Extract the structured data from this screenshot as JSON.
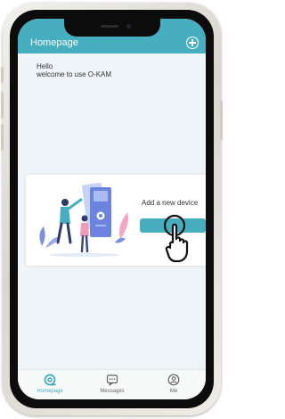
{
  "header": {
    "title": "Homepage",
    "add_icon": "plus-circle-icon"
  },
  "greeting": {
    "line1": "Hello",
    "line2": "welcome to use O-KAM"
  },
  "add_device_card": {
    "label": "Add a new device",
    "illustration": "people-with-device-illustration",
    "pointer_icon": "hand-pointer-icon"
  },
  "tabbar": {
    "tabs": [
      {
        "label": "Homepage",
        "icon": "homepage-icon",
        "active": true
      },
      {
        "label": "Messages",
        "icon": "message-icon",
        "active": false
      },
      {
        "label": "Me",
        "icon": "user-icon",
        "active": false
      }
    ]
  },
  "colors": {
    "accent": "#46aebe",
    "background": "#eef4f8"
  }
}
